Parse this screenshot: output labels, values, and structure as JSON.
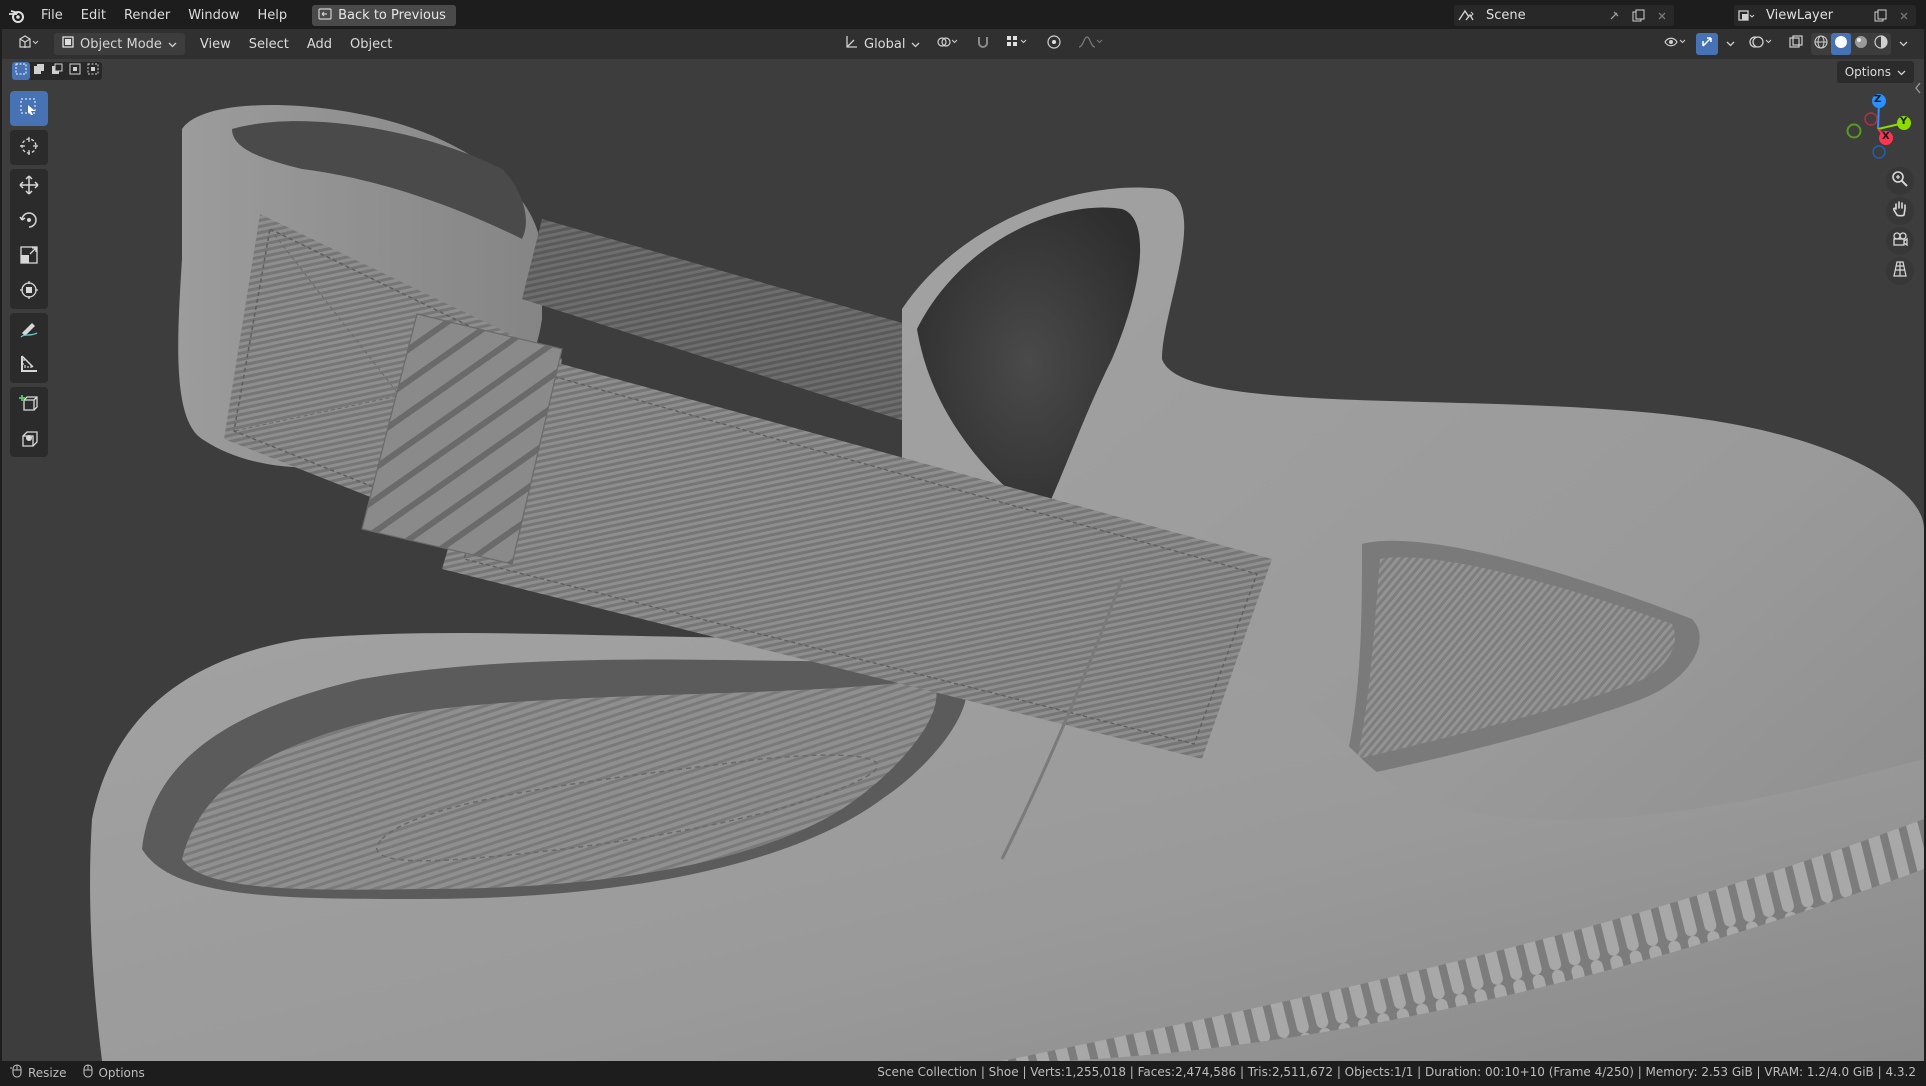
{
  "topbar": {
    "menus": [
      "File",
      "Edit",
      "Render",
      "Window",
      "Help"
    ],
    "back_button": "Back to Previous",
    "scene_name": "Scene",
    "view_layer": "ViewLayer"
  },
  "header": {
    "mode": "Object Mode",
    "menus": [
      "View",
      "Select",
      "Add",
      "Object"
    ],
    "transform_orientation": "Global"
  },
  "viewport": {
    "options_label": "Options",
    "gizmo_axes": [
      "Z",
      "Y",
      "X"
    ],
    "shading_active": "solid"
  },
  "statusbar": {
    "left_items": [
      "Resize",
      "Options"
    ],
    "right_text": "Scene Collection | Shoe | Verts:1,255,018 | Faces:2,474,586 | Tris:2,511,672 | Objects:1/1 | Duration: 00:10+10 (Frame 4/250) | Memory: 2.53 GiB | VRAM: 1.2/4.0 GiB | 4.3.2"
  },
  "colors": {
    "accent": "#4772b3",
    "viewport_bg": "#3d3d3d",
    "axis_x": "#ff3352",
    "axis_y": "#8bdc00",
    "axis_z": "#2890ff"
  }
}
